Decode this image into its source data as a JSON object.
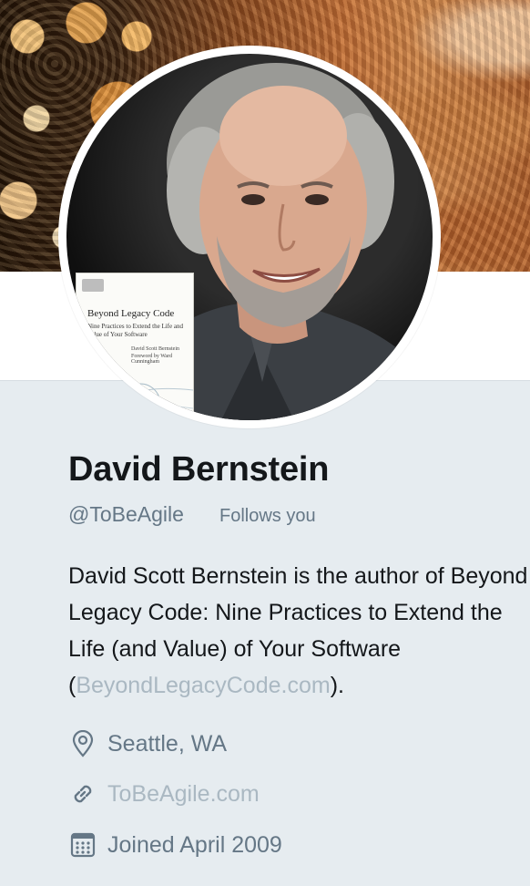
{
  "profile": {
    "name": "David Bernstein",
    "handle": "@ToBeAgile",
    "follows_you": "Follows you",
    "bio": {
      "text_before": "David Scott Bernstein is the author of Beyond Legacy Code: Nine Practices to Extend the Life (and Value) of Your Software (",
      "link": "BeyondLegacyCode.com",
      "text_after": ")."
    },
    "location": "Seattle, WA",
    "website": "ToBeAgile.com",
    "joined": "Joined April 2009"
  },
  "book": {
    "title": "Beyond Legacy Code",
    "subtitle": "Nine Practices to Extend the Life and Value of Your Software",
    "author": "David Scott Bernstein",
    "foreword": "Foreword by Ward Cunningham"
  },
  "icons": {
    "location": "map-pin-icon",
    "website": "link-icon",
    "joined": "calendar-icon"
  },
  "colors": {
    "background": "#e6ecf0",
    "text_primary": "#14171a",
    "text_secondary": "#657786",
    "link_muted": "#aab8c2"
  }
}
